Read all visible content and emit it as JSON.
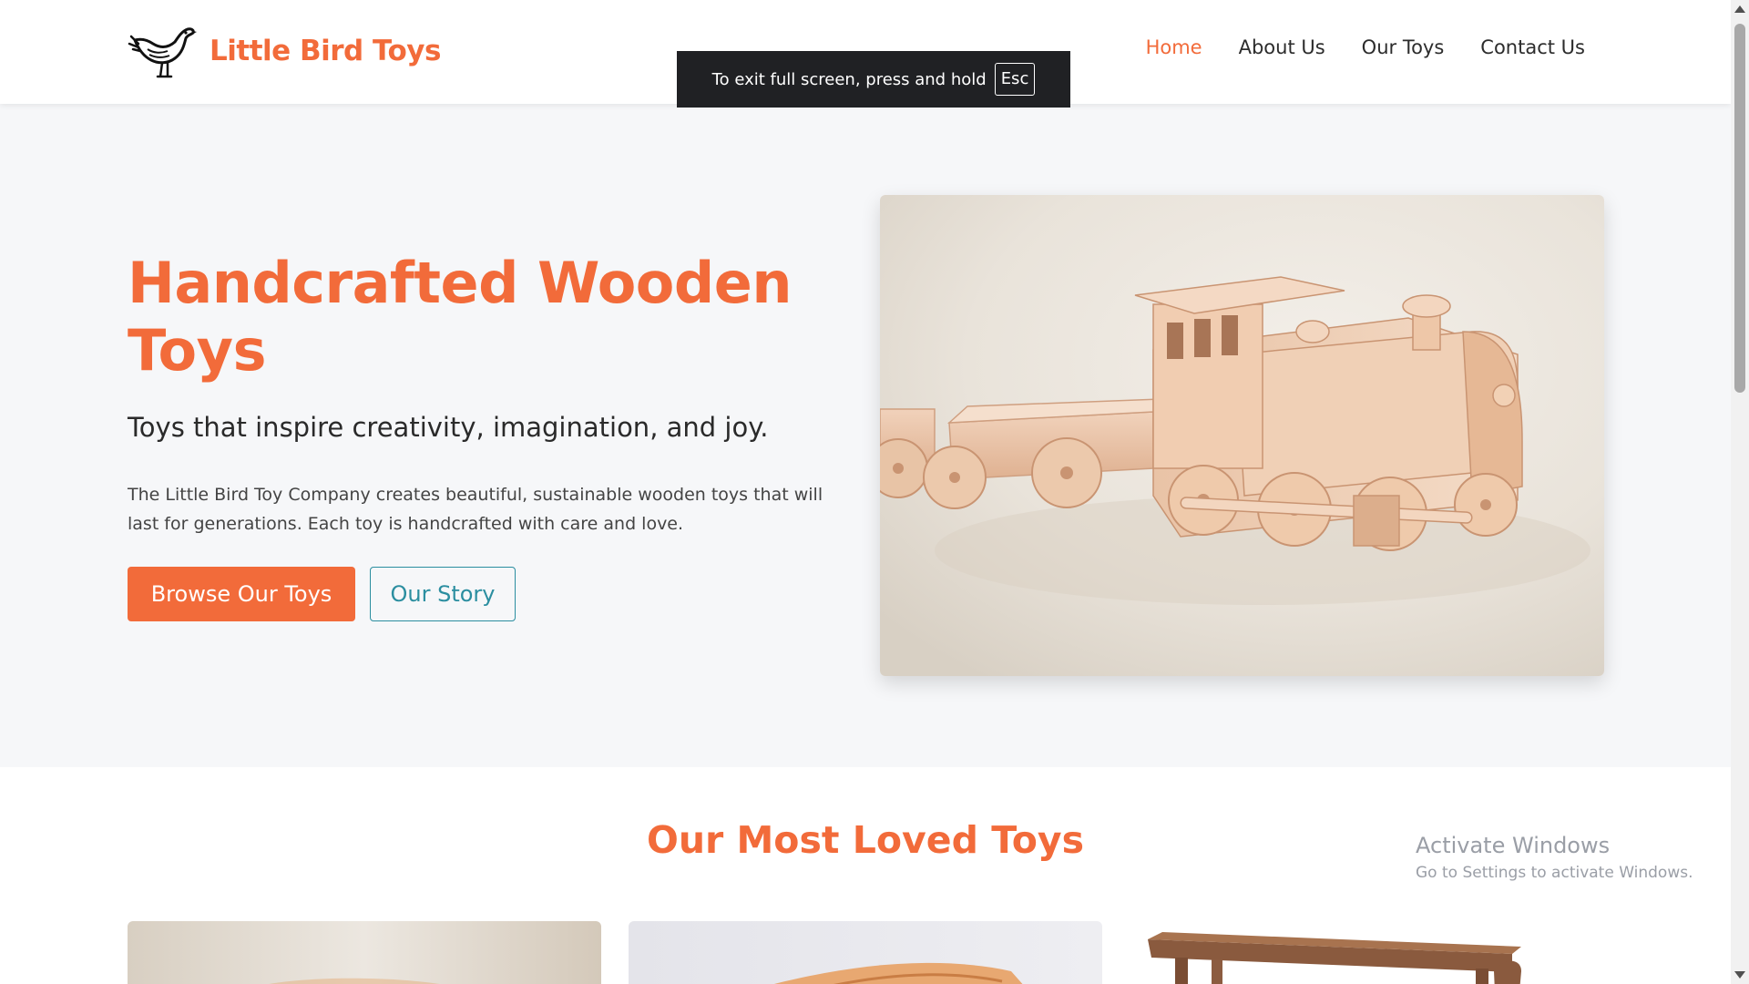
{
  "header": {
    "brand": "Little Bird Toys",
    "logo_icon": "bird-icon",
    "nav": [
      {
        "label": "Home",
        "active": true
      },
      {
        "label": "About Us",
        "active": false
      },
      {
        "label": "Our Toys",
        "active": false
      },
      {
        "label": "Contact Us",
        "active": false
      }
    ]
  },
  "fullscreen_notice": {
    "text": "To exit full screen, press and hold",
    "key": "Esc"
  },
  "hero": {
    "title": "Handcrafted Wooden Toys",
    "tagline": "Toys that inspire creativity, imagination, and joy.",
    "description": "The Little Bird Toy Company creates beautiful, sustainable wooden toys that will last for generations. Each toy is handcrafted with care and love.",
    "primary_button": "Browse Our Toys",
    "secondary_button": "Our Story",
    "image": "wooden-toy-train-photo"
  },
  "featured": {
    "title": "Our Most Loved Toys",
    "cards": [
      {
        "image": "wooden-toy-photo-1"
      },
      {
        "image": "wooden-toy-photo-2"
      },
      {
        "image": "wooden-chair-photo"
      }
    ]
  },
  "watermark": {
    "title": "Activate Windows",
    "subtitle": "Go to Settings to activate Windows."
  },
  "colors": {
    "accent": "#f26b3a",
    "teal": "#2b8ea0",
    "hero_bg": "#f6f7f9",
    "text": "#2c2c2c"
  }
}
